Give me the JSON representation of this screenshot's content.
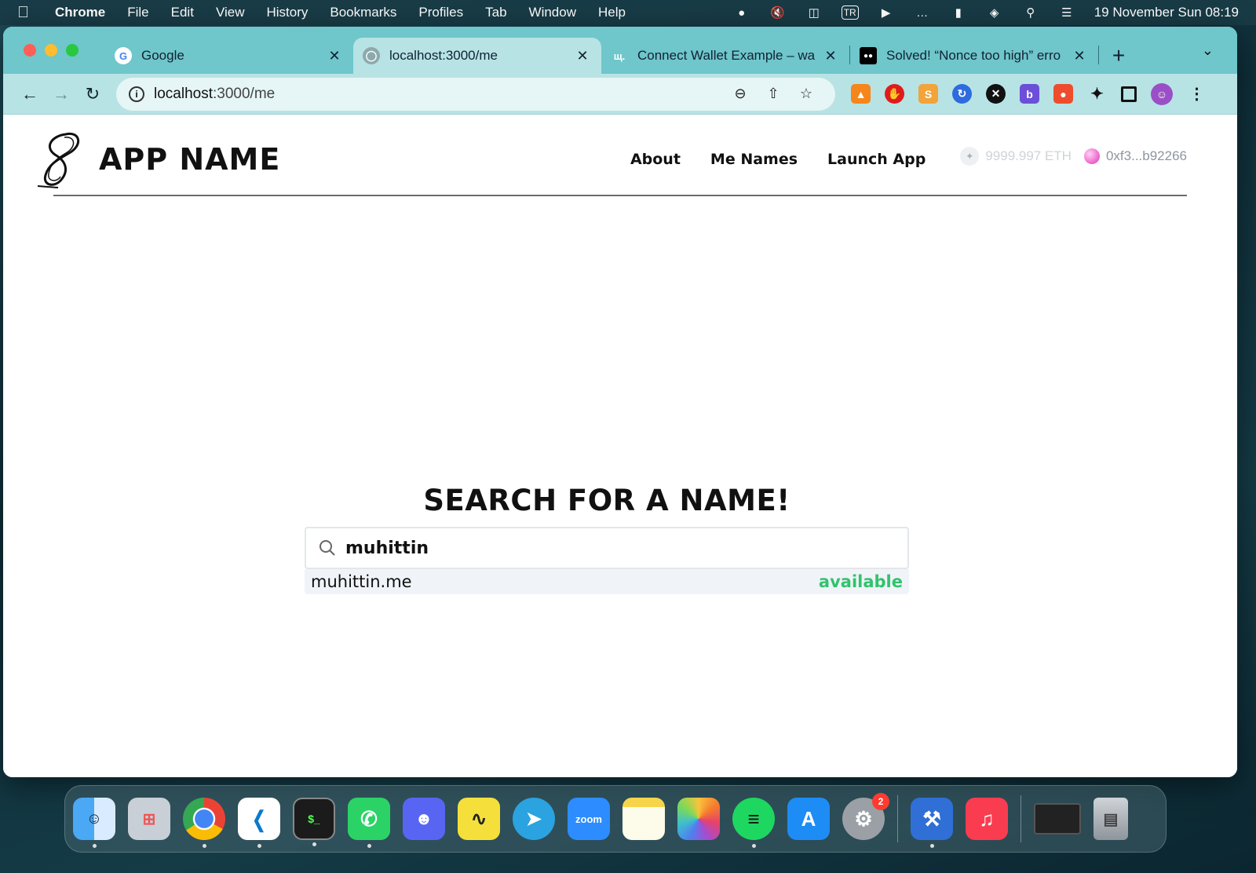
{
  "menubar": {
    "app": "Chrome",
    "items": [
      "File",
      "Edit",
      "View",
      "History",
      "Bookmarks",
      "Profiles",
      "Tab",
      "Window",
      "Help"
    ],
    "input_source": "TR",
    "clock": "19 November Sun  08:19"
  },
  "browser": {
    "tabs": [
      {
        "title": "Google",
        "icon": "google-icon"
      },
      {
        "title": "localhost:3000/me",
        "icon": "globe-icon"
      },
      {
        "title": "Connect Wallet Example – wa",
        "icon": "web3-icon"
      },
      {
        "title": "Solved! “Nonce too high” erro",
        "icon": "medium-icon"
      }
    ],
    "new_tab_label": "+",
    "url_host": "localhost",
    "url_path": ":3000/me"
  },
  "site": {
    "brand": "APP NAME",
    "nav": {
      "about": "About",
      "me_names": "Me Names",
      "launch_app": "Launch App"
    },
    "wallet": {
      "balance": "9999.997 ETH",
      "account": "0xf3...b92266"
    }
  },
  "search": {
    "title": "SEARCH FOR A NAME!",
    "query": "muhittin",
    "result_name": "muhittin.me",
    "result_status": "available"
  },
  "dock": {
    "settings_badge": "2"
  },
  "colors": {
    "tabstrip": "#6fc6cb",
    "toolbar": "#b7e3e4",
    "available": "#2fc46c"
  }
}
